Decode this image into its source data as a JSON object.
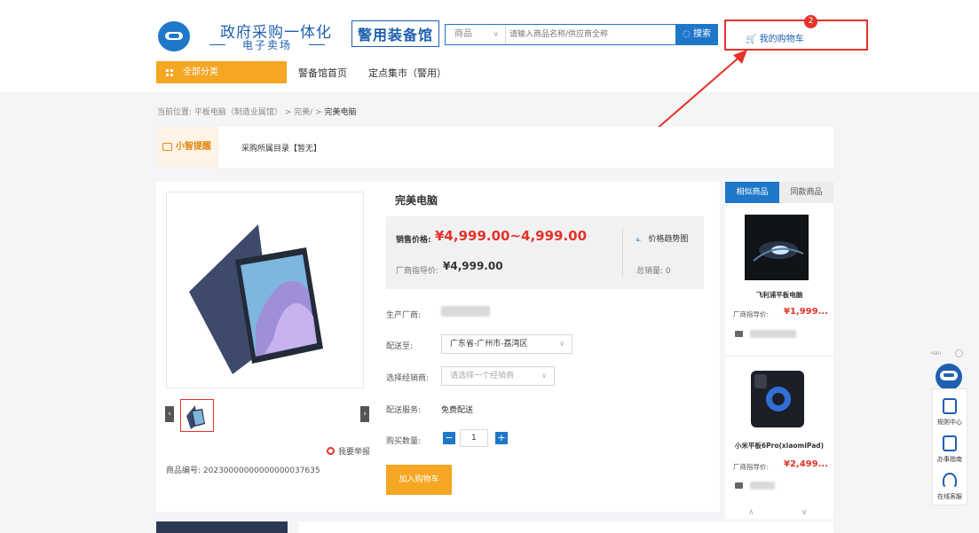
{
  "header": {
    "logo_title": "政府采购一体化",
    "logo_subtitle": "电子卖场",
    "pavilion": "警用装备馆",
    "search": {
      "category": "商品",
      "placeholder": "请输入商品名称/供应商全称",
      "button": "搜索"
    },
    "cart": {
      "label": "我的购物车",
      "count": "2"
    }
  },
  "nav": {
    "all_categories": "全部分类",
    "links": [
      "警备馆首页",
      "定点集市（警用）"
    ]
  },
  "breadcrumb": {
    "prefix": "当前位置:",
    "path": "平板电脑（制造业属馆） > 完美/ >",
    "current": "完美电脑"
  },
  "tip": {
    "badge": "小智提醒",
    "text": "采购所属目录【暂无】"
  },
  "product": {
    "title": "完美电脑",
    "price_label": "销售价格:",
    "price": "¥4,999.00~4,999.00",
    "ref_label": "厂商指导价:",
    "ref_price": "¥4,999.00",
    "trend_label": "价格趋势图",
    "sales": "总销量: 0",
    "manufacturer_label": "生产厂商:",
    "ship_to_label": "配送至:",
    "ship_to_value": "广东省-广州市-荔湾区",
    "dealer_label": "选择经销商:",
    "dealer_placeholder": "请选择一个经销商",
    "service_label": "配送服务:",
    "service_value": "免费配送",
    "qty_label": "购买数量:",
    "qty": "1",
    "add_to_cart": "加入购物车",
    "report": "我要举报",
    "sku": "商品编号: 20230000000000000037635"
  },
  "sidebar": {
    "tabs": [
      "相似商品",
      "同款商品"
    ],
    "items": [
      {
        "name": "飞利浦平板电脑",
        "ref_label": "厂商指导价:",
        "price": "¥1,999..."
      },
      {
        "name": "小米平板6Pro(xiaomiPad)",
        "ref_label": "厂商指导价:",
        "price": "¥2,499..."
      }
    ]
  },
  "dock": {
    "tiny": "nan",
    "items": [
      "规则中心",
      "办事指南",
      "在线客服"
    ]
  },
  "colors": {
    "brand_blue": "#1f77c9",
    "accent_orange": "#f5a623",
    "price_red": "#e5332a"
  }
}
